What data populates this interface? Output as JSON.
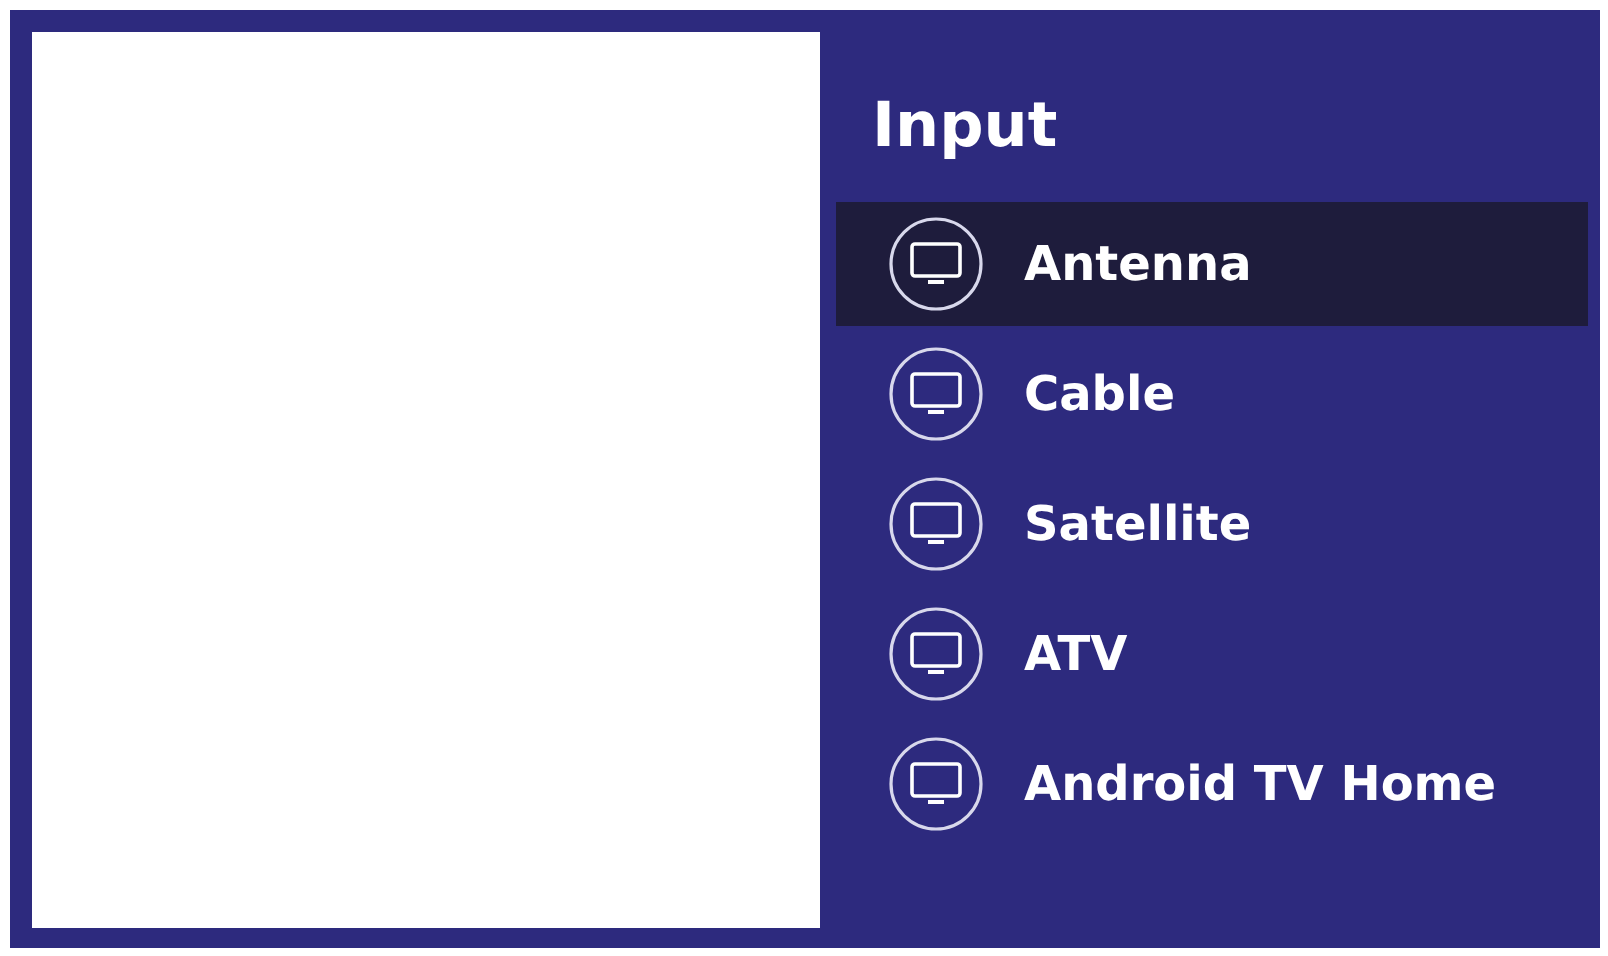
{
  "title": "Input",
  "inputs": [
    {
      "label": "Antenna",
      "selected": true
    },
    {
      "label": "Cable",
      "selected": false
    },
    {
      "label": "Satellite",
      "selected": false
    },
    {
      "label": "ATV",
      "selected": false
    },
    {
      "label": "Android TV Home",
      "selected": false
    }
  ]
}
